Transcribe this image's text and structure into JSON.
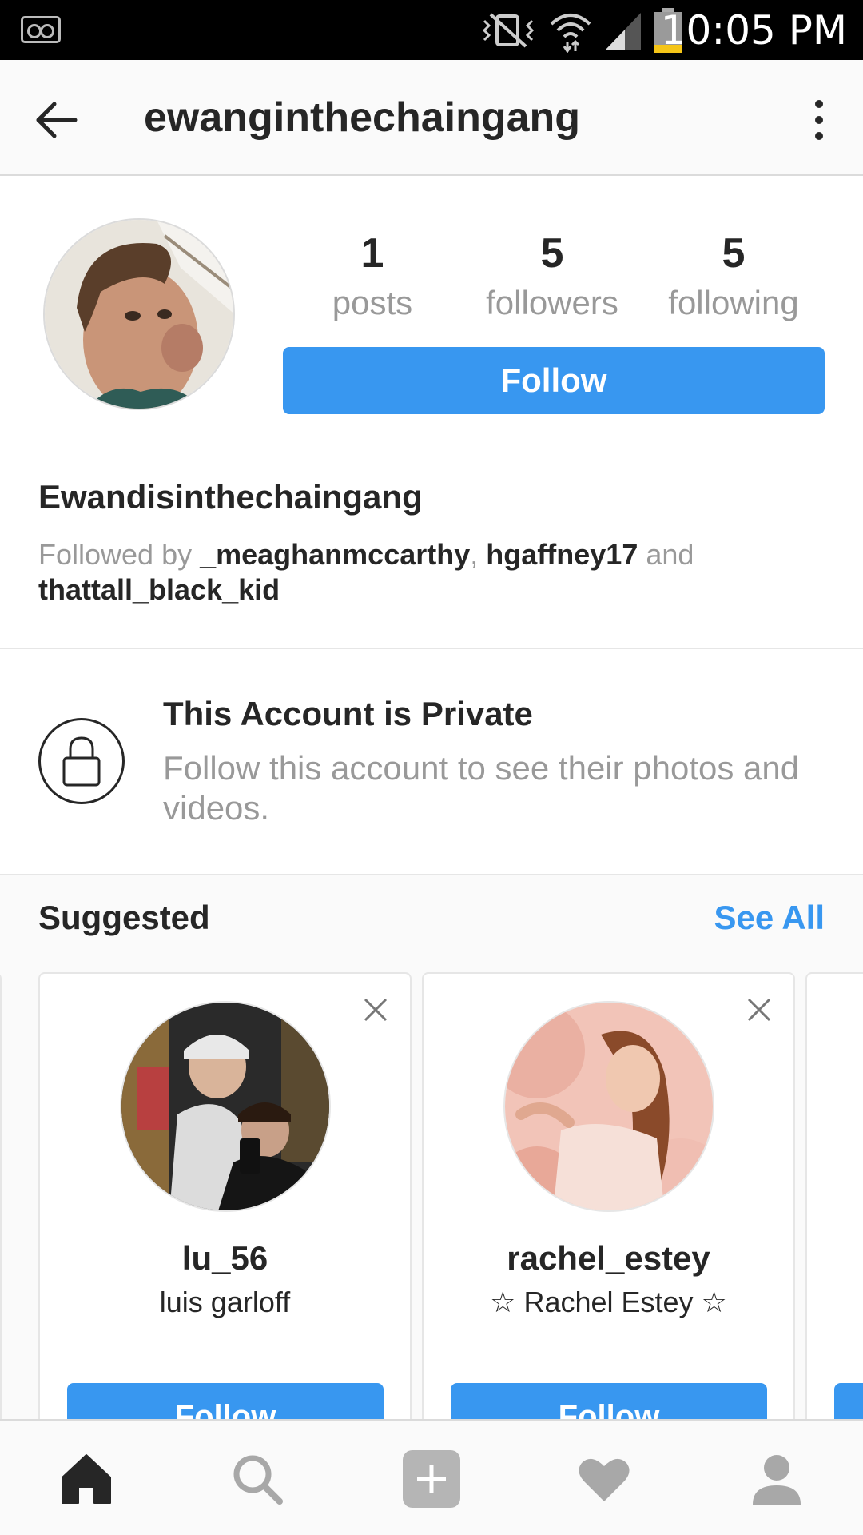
{
  "status_bar": {
    "time": "10:05 PM",
    "icons": [
      "voicemail-icon",
      "vibrate-mute-icon",
      "wifi-icon",
      "cell-signal-icon",
      "battery-low-icon"
    ]
  },
  "header": {
    "username": "ewanginthechaingang",
    "back_icon": "arrow-left-icon",
    "menu_icon": "more-vertical-icon"
  },
  "profile": {
    "stats": [
      {
        "value": "1",
        "label": "posts"
      },
      {
        "value": "5",
        "label": "followers"
      },
      {
        "value": "5",
        "label": "following"
      }
    ],
    "follow_label": "Follow",
    "display_name": "Ewandisinthechaingang",
    "followed_by": {
      "prefix": "Followed by ",
      "user1": "_meaghanmccarthy",
      "sep": ", ",
      "user2": "hgaffney17",
      "and": " and",
      "user3": "thattall_black_kid"
    }
  },
  "private": {
    "title": "This Account is Private",
    "description": "Follow this account to see their photos and videos."
  },
  "suggested": {
    "title": "Suggested",
    "see_all": "See All",
    "cards": [
      {
        "username": "lu_56",
        "name": "luis garloff",
        "button": "Follow"
      },
      {
        "username": "rachel_estey",
        "name": "☆ Rachel Estey ☆",
        "button": "Follow"
      }
    ]
  },
  "colors": {
    "accent": "#3897f0",
    "text": "#262626",
    "muted": "#999999"
  },
  "bottom_nav": [
    "home-icon",
    "search-icon",
    "add-post-icon",
    "activity-heart-icon",
    "profile-icon"
  ]
}
